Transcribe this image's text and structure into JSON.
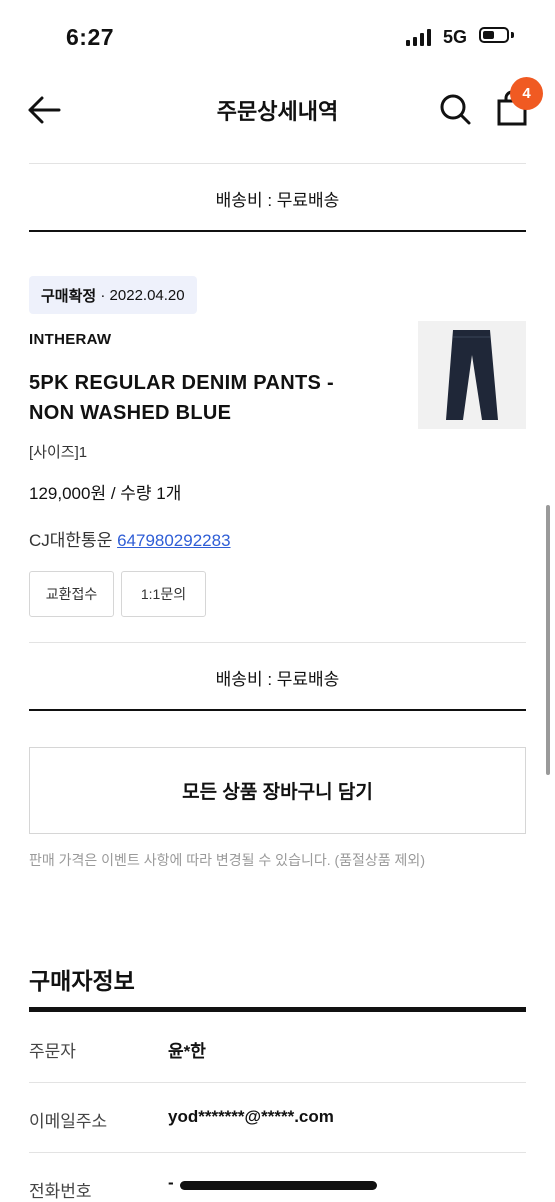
{
  "status_bar": {
    "time": "6:27",
    "network": "5G"
  },
  "header": {
    "title": "주문상세내역",
    "cart_count": "4"
  },
  "order": {
    "shipping_top": "배송비 : 무료배송",
    "status": "구매확정",
    "date": "· 2022.04.20",
    "brand": "INTHERAW",
    "product_line1": "5PK REGULAR DENIM PANTS -",
    "product_line2": "NON WASHED BLUE",
    "option": "[사이즈]1",
    "price": "129,000원 / 수량 1개",
    "courier": "CJ대한통운",
    "tracking": "647980292283",
    "exchange_button": "교환접수",
    "inquiry_button": "1:1문의",
    "shipping_bottom": "배송비 : 무료배송"
  },
  "cart_all_button": "모든 상품 장바구니 담기",
  "price_notice": "판매 가격은 이벤트 사항에 따라 변경될 수 있습니다. (품절상품 제외)",
  "buyer": {
    "section_title": "구매자정보",
    "rows": [
      {
        "label": "주문자",
        "value": "윤*한"
      },
      {
        "label": "이메일주소",
        "value": "yod*******@*****.com"
      },
      {
        "label": "전화번호",
        "value": "-"
      }
    ]
  },
  "colors": {
    "badge": "#f05a22",
    "tag_bg": "#eef1fb",
    "link": "#2f5ed6",
    "pants": "#1f2738"
  }
}
